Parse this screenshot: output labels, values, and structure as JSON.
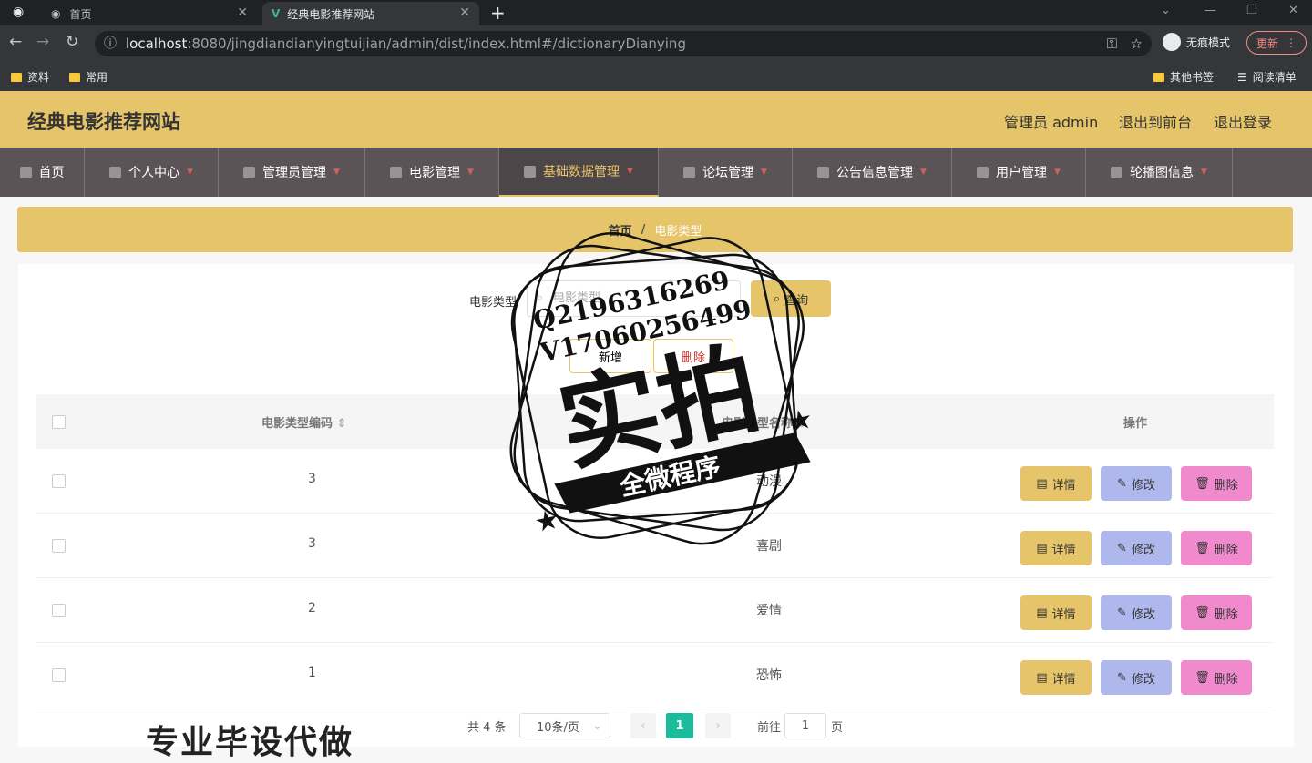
{
  "browser": {
    "tabs": [
      {
        "label": "首页"
      },
      {
        "label": "经典电影推荐网站"
      }
    ],
    "url_host": "localhost",
    "url_rest": ":8080/jingdiandianyingtuijian/admin/dist/index.html#/dictionaryDianying",
    "incognito_label": "无痕模式",
    "update_label": "更新",
    "bookmarks": [
      "资料",
      "常用"
    ],
    "bookmarks_right": [
      "其他书签",
      "阅读清单"
    ]
  },
  "header": {
    "title": "经典电影推荐网站",
    "user": "管理员 admin",
    "front_link": "退出到前台",
    "logout": "退出登录"
  },
  "menu": [
    {
      "label": "首页",
      "icon": "home-icon"
    },
    {
      "label": "个人中心",
      "icon": "user-icon"
    },
    {
      "label": "管理员管理",
      "icon": "gauge-icon"
    },
    {
      "label": "电影管理",
      "icon": "film-icon"
    },
    {
      "label": "基础数据管理",
      "icon": "briefcase-icon",
      "active": true
    },
    {
      "label": "论坛管理",
      "icon": "document-icon"
    },
    {
      "label": "公告信息管理",
      "icon": "monitor-icon"
    },
    {
      "label": "用户管理",
      "icon": "bar-chart-icon"
    },
    {
      "label": "轮播图信息",
      "icon": "send-icon"
    }
  ],
  "breadcrumb": {
    "home": "首页",
    "separator": "/",
    "current": "电影类型"
  },
  "search": {
    "label": "电影类型",
    "placeholder": "电影类型",
    "button": "查询"
  },
  "actions": {
    "add": "新增",
    "delete": "删除"
  },
  "table": {
    "headers": {
      "code": "电影类型编码",
      "name": "电影类型名称",
      "ops": "操作"
    },
    "rows": [
      {
        "code": "3",
        "name": "动漫"
      },
      {
        "code": "3",
        "name": "喜剧"
      },
      {
        "code": "2",
        "name": "爱情"
      },
      {
        "code": "1",
        "name": "恐怖"
      }
    ],
    "op_labels": {
      "detail": "详情",
      "edit": "修改",
      "remove": "删除"
    }
  },
  "pagination": {
    "total": "共 4 条",
    "page_size": "10条/页",
    "current": "1",
    "goto_prefix": "前往",
    "goto_value": "1",
    "goto_suffix": "页"
  },
  "overlay": {
    "qq": "Q2196316269",
    "vx": "V17060256499",
    "stamp_big": "实拍",
    "stamp_ribbon": "全微程序",
    "promo": "专业毕设代做"
  },
  "colors": {
    "accent": "#e6c46a",
    "menu_bg": "#5b5356",
    "edit": "#aeb8ec",
    "remove": "#f08acc",
    "pager": "#1abc9c"
  }
}
